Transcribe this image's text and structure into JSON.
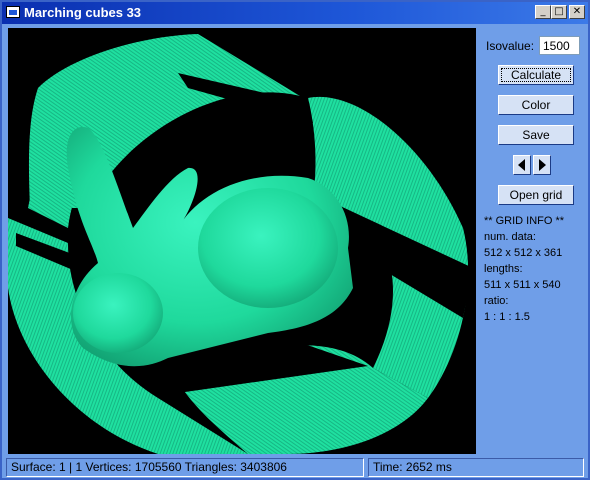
{
  "window": {
    "title": "Marching cubes 33"
  },
  "titlebar_buttons": {
    "minimize": "_",
    "maximize": "□",
    "close": "✕"
  },
  "sidebar": {
    "isovalue_label": "Isovalue:",
    "isovalue": "1500",
    "buttons": {
      "calculate": "Calculate",
      "color": "Color",
      "save": "Save",
      "open_grid": "Open grid"
    },
    "icons": {
      "prev": "left-arrow-icon",
      "next": "right-arrow-icon"
    },
    "info": {
      "header": "** GRID  INFO **",
      "num_data_label": "num. data:",
      "num_data": "512 x 512 x 361",
      "lengths_label": "lengths:",
      "lengths": "511 x 511 x 540",
      "ratio_label": "ratio:",
      "ratio": "1 : 1 : 1.5"
    }
  },
  "status": {
    "surface": "Surface: 1 | 1   Vertices: 1705560   Triangles: 3403806",
    "time": "Time: 2652 ms"
  },
  "colors": {
    "surface": "#1fe8a6",
    "viewport_bg": "#000000",
    "window_bg": "#6f9ee8"
  }
}
